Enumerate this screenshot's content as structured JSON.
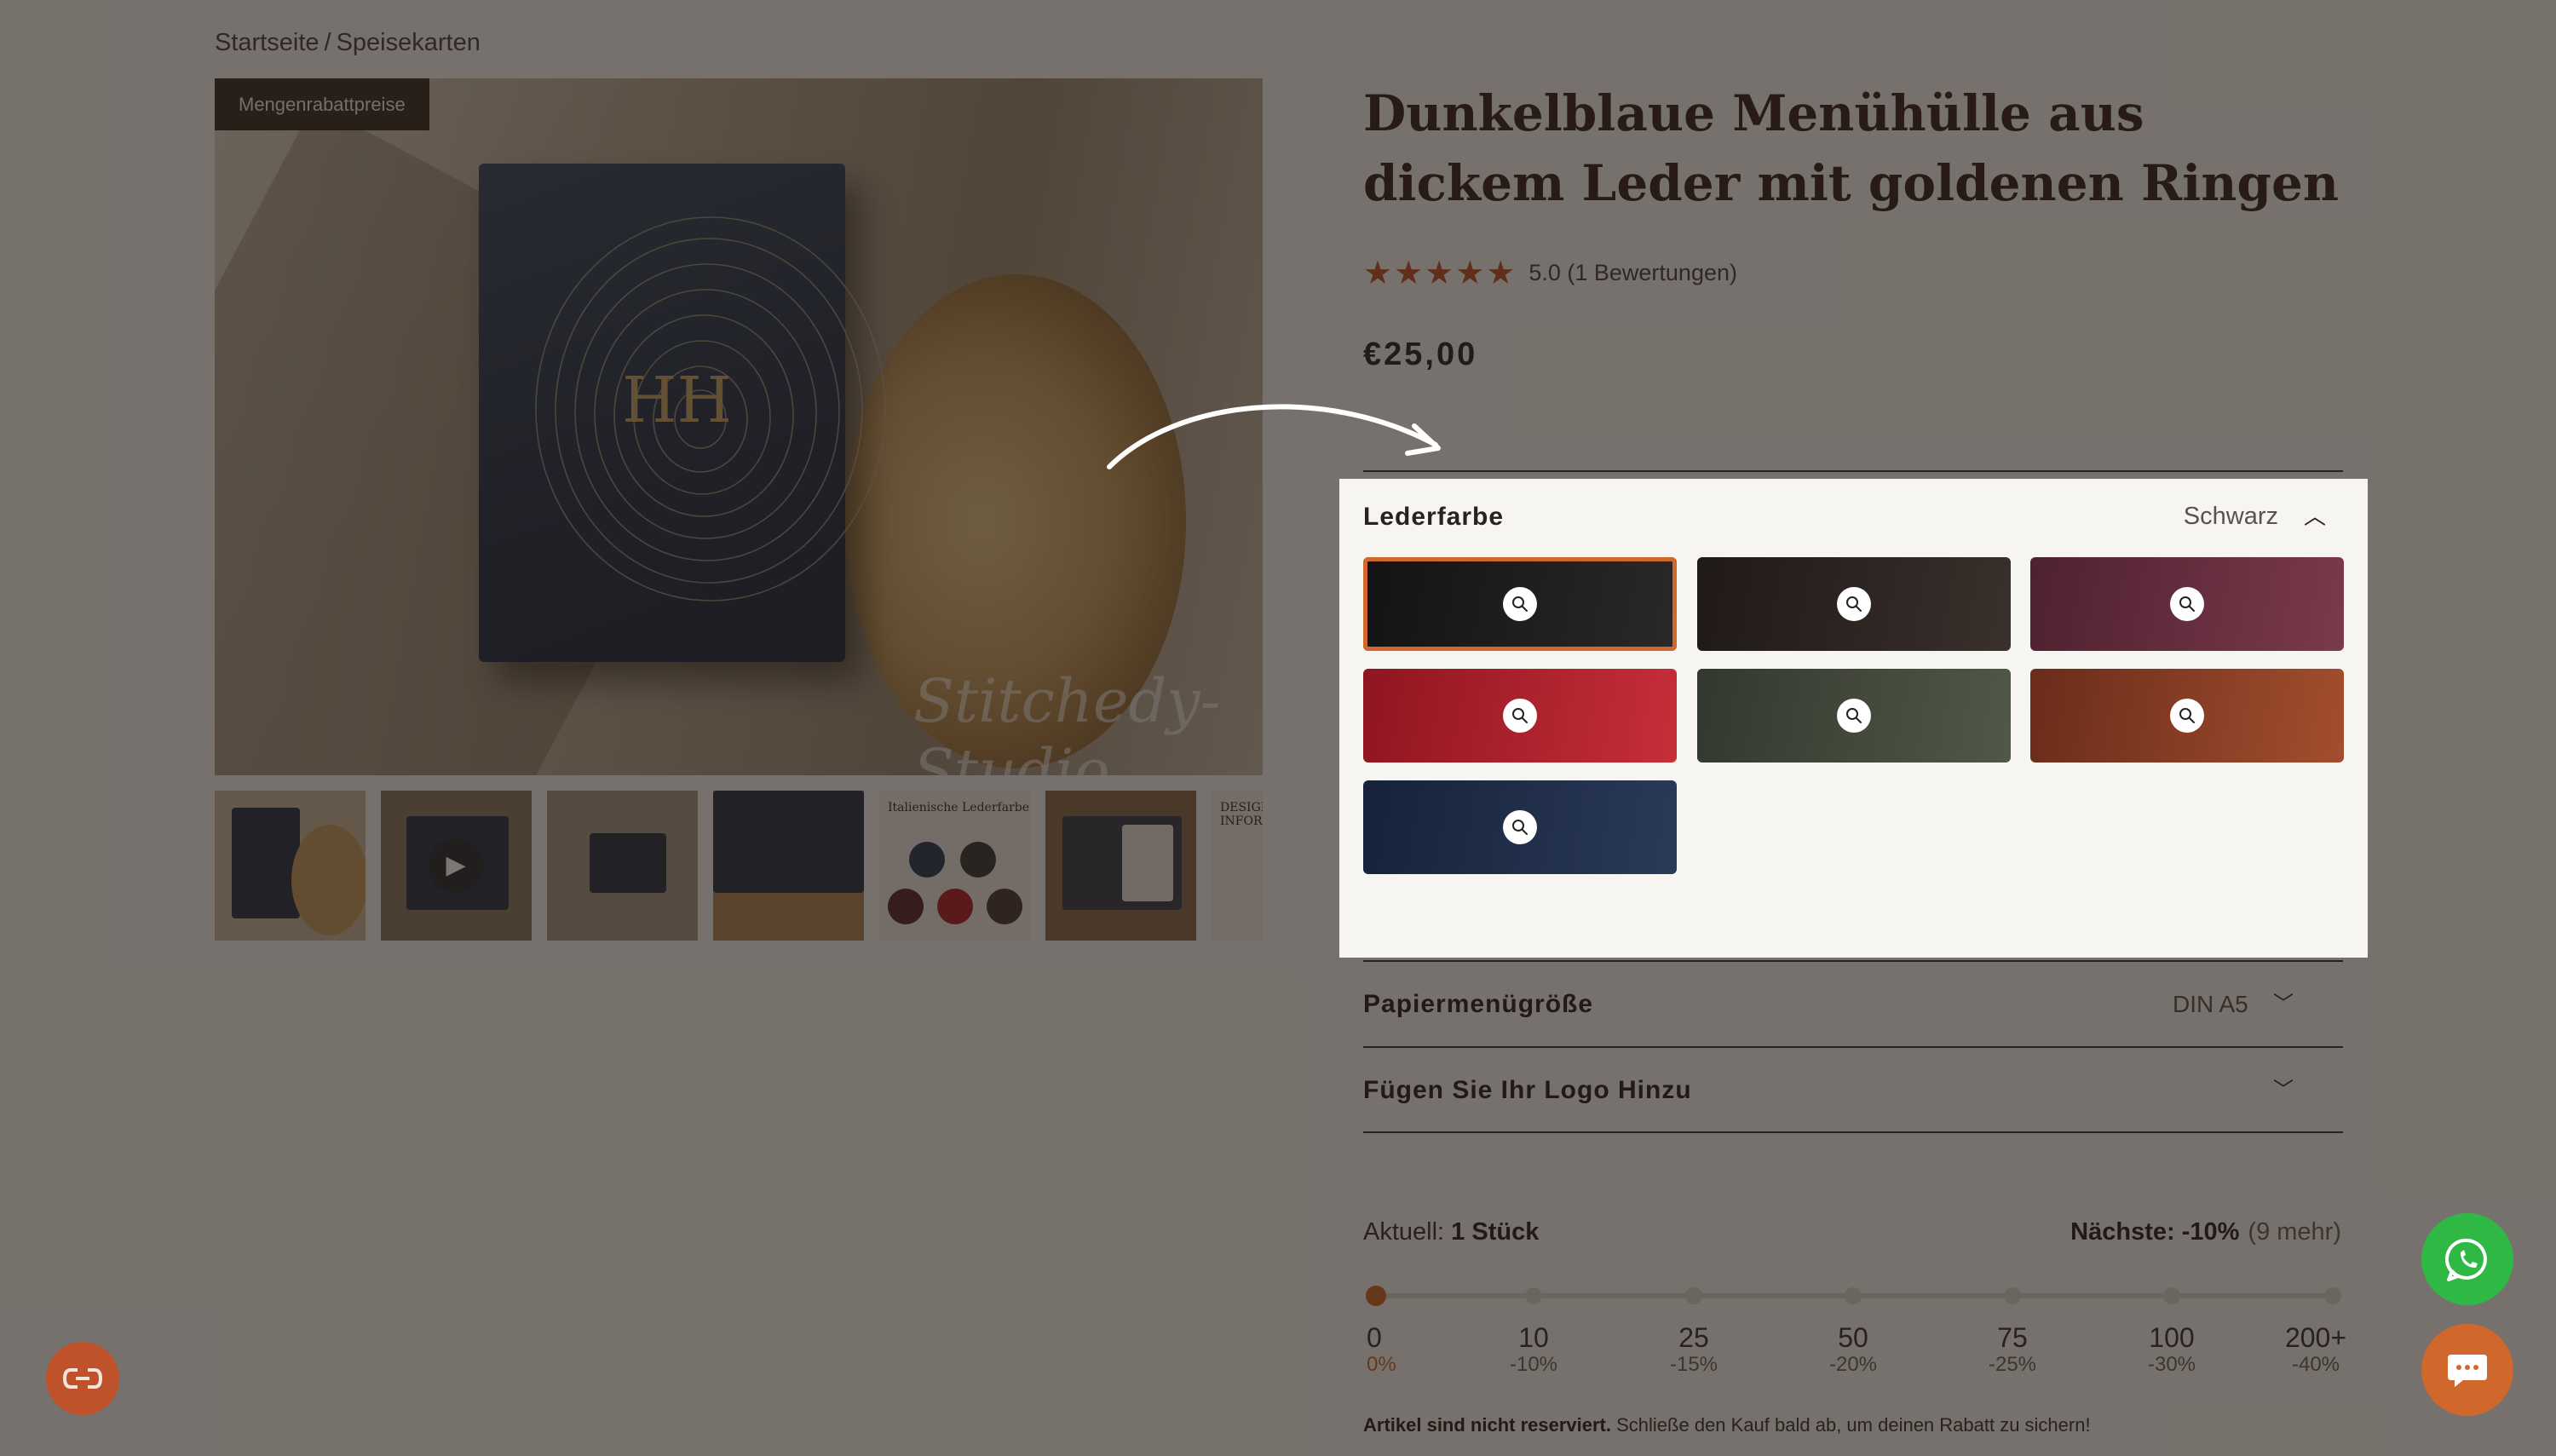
{
  "breadcrumb": {
    "home": "Startseite",
    "separator": "/",
    "current": "Speisekarten"
  },
  "gallery": {
    "badge": "Mengenrabattpreise",
    "watermark": "Stitchedy-Studio",
    "monogram": "HH",
    "thumb_labels": [
      "Italienische Lederfarbe",
      "DESIGN INFORMATION"
    ]
  },
  "product": {
    "title": "Dunkelblaue Menühülle aus dickem Leder mit goldenen Ringen",
    "stars": "★★★★★",
    "rating_text": "5.0 (1 Bewertungen)",
    "price": "€25,00"
  },
  "leather_color": {
    "label": "Lederfarbe",
    "selected": "Schwarz",
    "swatches": [
      {
        "name": "black",
        "color": "#1e1c1c",
        "active": true
      },
      {
        "name": "dark-brown",
        "color": "#2b2220",
        "active": false
      },
      {
        "name": "burgundy",
        "color": "#6a2c3c",
        "active": false
      },
      {
        "name": "red",
        "color": "#b01f2b",
        "active": false
      },
      {
        "name": "olive-green",
        "color": "#42463a",
        "active": false
      },
      {
        "name": "cognac",
        "color": "#8a3f25",
        "active": false
      },
      {
        "name": "navy",
        "color": "#1f2c45",
        "active": false
      }
    ]
  },
  "paper_size": {
    "label": "Papiermenügröße",
    "value": "DIN A5"
  },
  "logo": {
    "label": "Fügen Sie Ihr Logo Hinzu"
  },
  "quantity": {
    "current_label": "Aktuell:",
    "current_value": "1 Stück",
    "next_label": "Nächste: -10%",
    "next_more": "(9 mehr)",
    "tiers": [
      {
        "qty": "0",
        "pct": "0%"
      },
      {
        "qty": "10",
        "pct": "-10%"
      },
      {
        "qty": "25",
        "pct": "-15%"
      },
      {
        "qty": "50",
        "pct": "-20%"
      },
      {
        "qty": "75",
        "pct": "-25%"
      },
      {
        "qty": "100",
        "pct": "-30%"
      },
      {
        "qty": "200+",
        "pct": "-40%"
      }
    ],
    "note_bold": "Artikel sind nicht reserviert.",
    "note_text": "Schließe den Kauf bald ab, um deinen Rabatt zu sichern!"
  },
  "colors": {
    "accent": "#d0682d",
    "whatsapp": "#2fb944",
    "star": "#c0522b"
  }
}
